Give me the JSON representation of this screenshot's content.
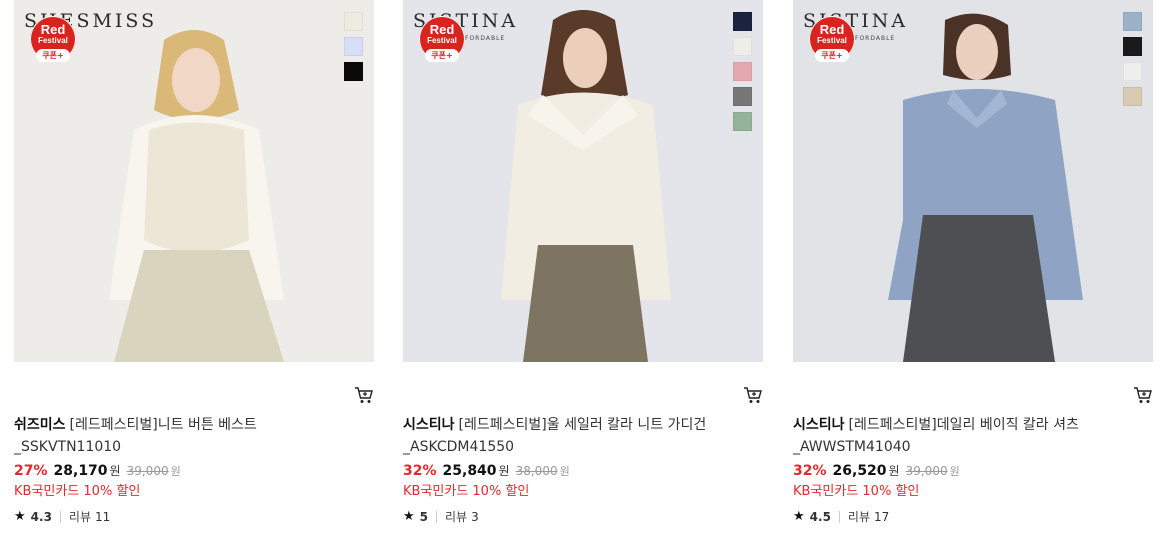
{
  "badge": {
    "line1": "Red",
    "line2": "Festival",
    "coupon": "쿠폰+"
  },
  "products": [
    {
      "watermark": "SHESMISS",
      "watermark_sub": "",
      "swatches": [
        "#efebe0",
        "#d8def5",
        "#0a0a0a"
      ],
      "brand": "쉬즈미스",
      "name": "[레드페스티벌]니트 버튼 베스트 _SSKVTN11010",
      "discount": "27%",
      "price": "28,170",
      "currency": "원",
      "original_price": "39,000",
      "original_currency": "원",
      "promo": "KB국민카드 10% 할인",
      "rating": "4.3",
      "review_label": "리뷰",
      "review_count": "11"
    },
    {
      "watermark": "SISTINA",
      "watermark_sub": "FORDABLE",
      "swatches": [
        "#1c2340",
        "#eeede8",
        "#e3a9b1",
        "#777777",
        "#94b49a"
      ],
      "brand": "시스티나",
      "name": "[레드페스티벌]울 세일러 칼라 니트 가디건 _ASKCDM41550",
      "discount": "32%",
      "price": "25,840",
      "currency": "원",
      "original_price": "38,000",
      "original_currency": "원",
      "promo": "KB국민카드 10% 할인",
      "rating": "5",
      "review_label": "리뷰",
      "review_count": "3"
    },
    {
      "watermark": "SISTINA",
      "watermark_sub": "FORDABLE",
      "swatches": [
        "#9db1c9",
        "#1a1a1a",
        "#eeeeee",
        "#d8c9b1"
      ],
      "brand": "시스티나",
      "name": "[레드페스티벌]데일리 베이직 칼라 셔츠 _AWWSTM41040",
      "discount": "32%",
      "price": "26,520",
      "currency": "원",
      "original_price": "39,000",
      "original_currency": "원",
      "promo": "KB국민카드 10% 할인",
      "rating": "4.5",
      "review_label": "리뷰",
      "review_count": "17"
    }
  ]
}
